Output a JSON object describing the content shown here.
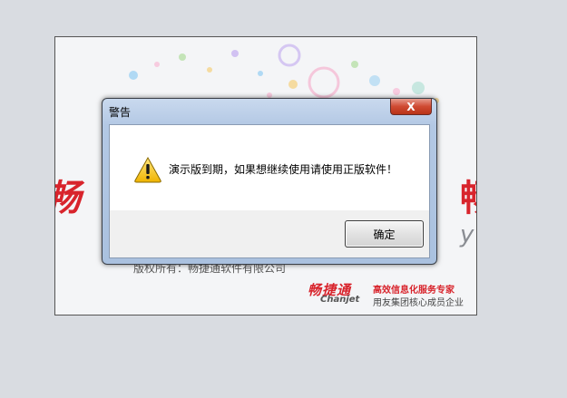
{
  "splash": {
    "left_logo_fragment": "畅",
    "right_logo_fragment": "畅",
    "right_gray_fragment": "y",
    "copyright": "版权所有：畅捷通软件有限公司",
    "brand": {
      "name_cn": "畅捷通",
      "name_en": "Chanjet",
      "slogan": "高效信息化服务专家",
      "subtitle": "用友集团核心成员企业"
    }
  },
  "dialog": {
    "title": "警告",
    "close_symbol": "X",
    "message": "演示版到期，如果想继续使用请使用正版软件！",
    "ok_label": "确定",
    "icon": "warning-icon"
  },
  "colors": {
    "brand_red": "#d8242c",
    "title_bar": "#b3c8e4",
    "close_red": "#cf4a32"
  }
}
